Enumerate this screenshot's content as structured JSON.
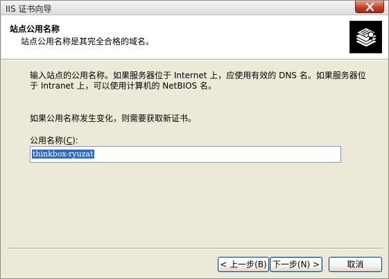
{
  "window": {
    "title": "IIS 证书向导"
  },
  "header": {
    "title": "站点公用名称",
    "subtitle": "站点公用名称是其完全合格的域名。"
  },
  "content": {
    "description": "输入站点的公用名称。如果服务器位于 Internet 上，应使用有效的 DNS 名。如果服务器位于 Intranet 上，可以使用计算机的 NetBIOS 名。",
    "note": "如果公用名称发生变化，则需要获取新证书。",
    "field_label_prefix": "公用名称(",
    "field_label_hotkey": "C",
    "field_label_suffix": "):",
    "common_name_value": "thinkbox-ryuzat"
  },
  "buttons": {
    "back": "< 上一步(B)",
    "next": "下一步(N) >",
    "cancel": "取消"
  },
  "icons": {
    "close": "close-icon",
    "header": "certificate-icon"
  }
}
